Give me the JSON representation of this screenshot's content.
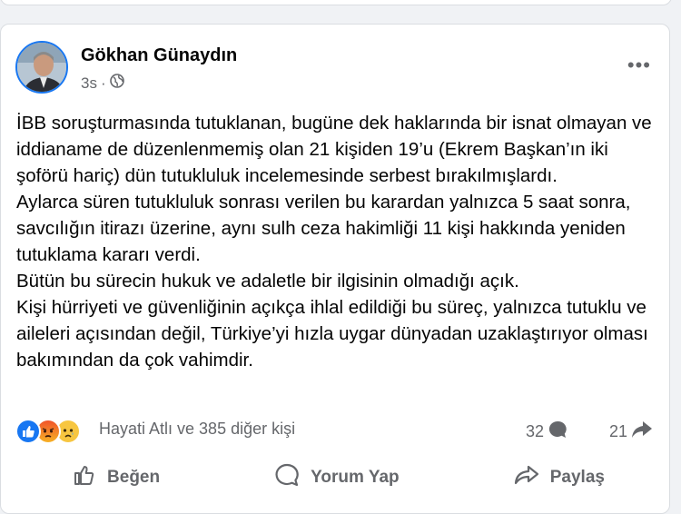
{
  "post": {
    "author": "Gökhan Günaydın",
    "time": "3s",
    "privacy_icon": "globe-icon",
    "more_icon": "ellipsis-icon",
    "body": [
      "İBB soruşturmasında tutuklanan, bugüne dek haklarında bir isnat olmayan ve iddianame de düzenlenmemiş olan 21 kişiden 19’u (Ekrem Başkan’ın iki şoförü hariç) dün tutukluluk incelemesinde serbest bırakılmışlardı.",
      "Aylarca süren tutukluluk sonrası verilen bu karardan yalnızca 5 saat sonra, savcılığın itirazı üzerine, aynı sulh ceza hakimliği 11 kişi hakkında yeniden tutuklama kararı verdi.",
      "Bütün bu sürecin hukuk ve adaletle bir ilgisinin olmadığı açık.",
      "Kişi hürriyeti ve güvenliğinin açıkça ihlal edildiği bu süreç, yalnızca tutuklu ve aileleri açısından değil, Türkiye’yi hızla uygar dünyadan uzaklaştırıyor olması bakımından da çok vahimdir."
    ],
    "reactions": {
      "summary": "Hayati Atlı ve 385 diğer kişi",
      "icons": [
        "like-reaction-icon",
        "angry-reaction-icon",
        "sad-reaction-icon"
      ],
      "comments": "32",
      "shares": "21"
    },
    "actions": {
      "like": "Beğen",
      "comment": "Yorum Yap",
      "share": "Paylaş"
    }
  }
}
